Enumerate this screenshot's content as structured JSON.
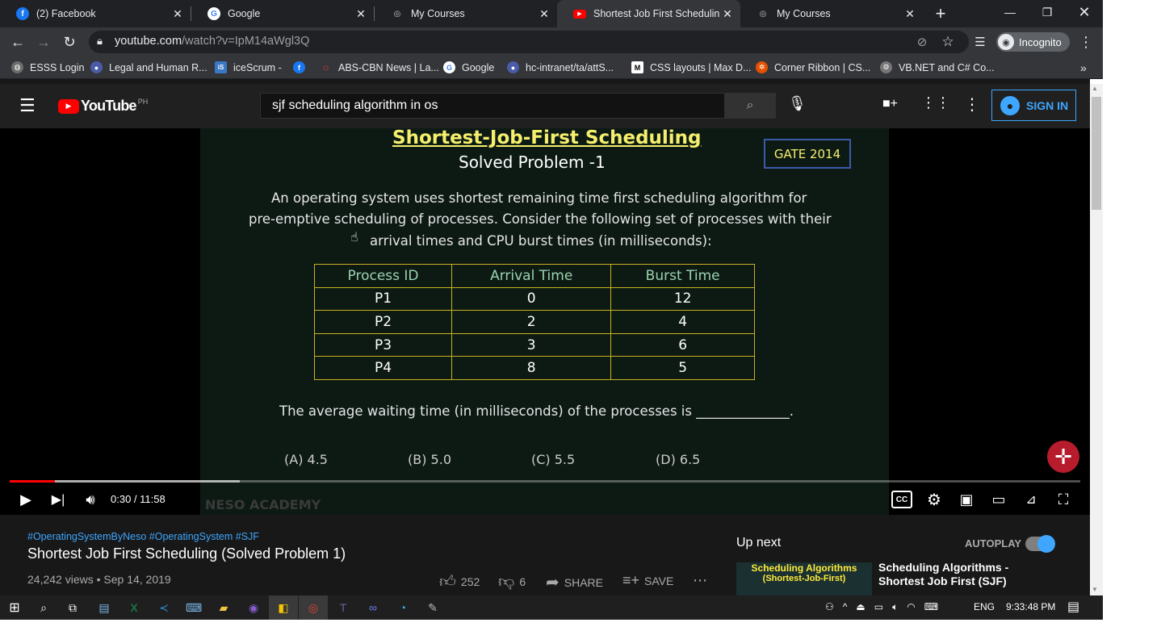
{
  "browser": {
    "tabs": [
      {
        "label": "(2) Facebook",
        "icon": "facebook-icon",
        "color": "#1877f2",
        "glyph": "f"
      },
      {
        "label": "Google",
        "icon": "google-icon",
        "color": "#ffffff",
        "glyph": "G"
      },
      {
        "label": "My Courses",
        "icon": "moodle-icon",
        "color": "#5f6368",
        "glyph": "◎"
      },
      {
        "label": "Shortest Job First Scheduling (S",
        "icon": "youtube-icon",
        "color": "#ff0000",
        "glyph": "▶"
      },
      {
        "label": "My Courses",
        "icon": "moodle-icon",
        "color": "#5f6368",
        "glyph": "◎"
      }
    ],
    "url_host": "youtube.com",
    "url_path": "/watch?v=IpM14aWgl3Q",
    "profile_label": "Incognito",
    "bookmarks": [
      {
        "label": "ESSS Login",
        "color": "#6d6d6d",
        "glyph": "●"
      },
      {
        "label": "Legal and Human R...",
        "color": "#4a5ca8",
        "glyph": "●"
      },
      {
        "label": "iceScrum -",
        "color": "#3a78c3",
        "glyph": "iS"
      },
      {
        "label": "",
        "color": "#1877f2",
        "glyph": "f"
      },
      {
        "label": "ABS-CBN News | La...",
        "color": "#c62828",
        "glyph": "○"
      },
      {
        "label": "Google",
        "color": "#ffffff",
        "glyph": "G"
      },
      {
        "label": "hc-intranet/ta/attS...",
        "color": "#4a5ca8",
        "glyph": "●"
      },
      {
        "label": "CSS layouts | Max D...",
        "color": "#ffffff",
        "glyph": "M"
      },
      {
        "label": "Corner Ribbon | CS...",
        "color": "#e65100",
        "glyph": "❂"
      },
      {
        "label": "VB.NET and C# Co...",
        "color": "#777777",
        "glyph": "⚙"
      }
    ]
  },
  "youtube": {
    "logo": "YouTube",
    "region": "PH",
    "search_value": "sjf scheduling algorithm in os",
    "sign_in": "SIGN IN"
  },
  "video": {
    "heading": "Shortest-Job-First Scheduling",
    "subheading": "Solved Problem -1",
    "badge": "GATE 2014",
    "problem_lines": [
      "An operating system uses shortest remaining time first scheduling algorithm for",
      "pre-emptive scheduling of processes. Consider the following set of processes with their",
      "arrival times and CPU burst times (in milliseconds):"
    ],
    "table_headers": [
      "Process ID",
      "Arrival Time",
      "Burst Time"
    ],
    "table_rows": [
      [
        "P1",
        "0",
        "12"
      ],
      [
        "P2",
        "2",
        "4"
      ],
      [
        "P3",
        "3",
        "6"
      ],
      [
        "P4",
        "8",
        "5"
      ]
    ],
    "question": "The average waiting time (in milliseconds) of the processes is ______________.",
    "options": [
      "(A) 4.5",
      "(B) 5.0",
      "(C) 5.5",
      "(D) 6.5"
    ],
    "watermark": "NESO ACADEMY",
    "time": "0:30 / 11:58",
    "progress_played": 0.042,
    "progress_buffered": 0.215
  },
  "meta": {
    "tags": "#OperatingSystemByNeso #OperatingSystem #SJF",
    "title": "Shortest Job First Scheduling (Solved Problem 1)",
    "views": "24,242 views • Sep 14, 2019",
    "likes": "252",
    "dislikes": "6",
    "share": "SHARE",
    "save": "SAVE"
  },
  "sidebar": {
    "up_next": "Up next",
    "autoplay": "AUTOPLAY",
    "rec_title_1": "Scheduling Algorithms -",
    "rec_title_2": "Shortest Job First (SJF)",
    "thumb_title_1": "Scheduling Algorithms",
    "thumb_title_2": "(Shortest-Job-First)"
  },
  "taskbar": {
    "lang": "ENG",
    "clock": "9:33:48 PM"
  }
}
